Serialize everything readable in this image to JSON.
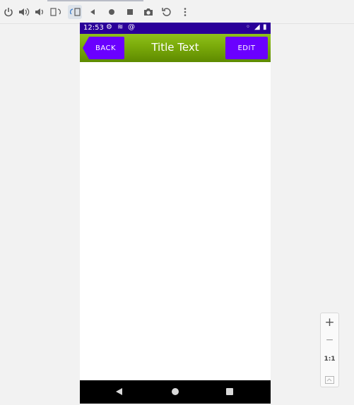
{
  "toolbar": {
    "icons": [
      "power-icon",
      "volume-up-icon",
      "volume-down-icon",
      "rotate-left-icon",
      "rotate-right-icon",
      "back-icon",
      "home-icon",
      "overview-icon",
      "camera-icon",
      "replay-icon",
      "more-icon"
    ]
  },
  "phone": {
    "status": {
      "time": "12:53"
    },
    "appbar": {
      "back_label": "BACK",
      "title": "Title Text",
      "edit_label": "EDIT",
      "colors": {
        "bar": "#7aaa0a",
        "button": "#6a00ff",
        "statusbar": "#2a0099"
      }
    }
  },
  "zoom_controls": {
    "zoom_in": "+",
    "zoom_out": "−",
    "one_to_one": "1:1"
  }
}
